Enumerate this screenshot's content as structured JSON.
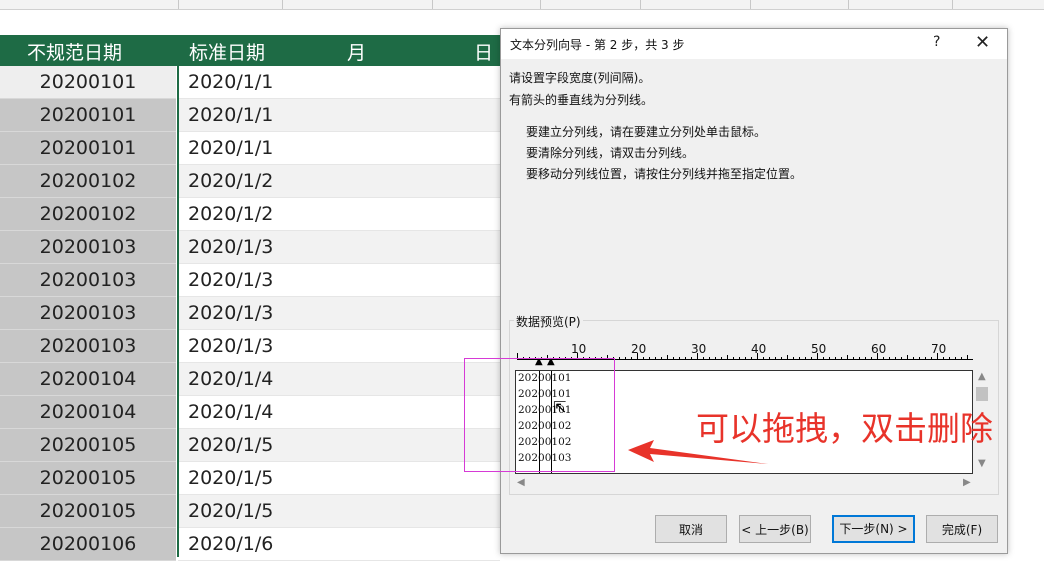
{
  "sheet": {
    "headers": [
      "不规范日期",
      "标准日期",
      "月",
      "日"
    ],
    "rows": [
      [
        "20200101",
        "2020/1/1"
      ],
      [
        "20200101",
        "2020/1/1"
      ],
      [
        "20200101",
        "2020/1/1"
      ],
      [
        "20200102",
        "2020/1/2"
      ],
      [
        "20200102",
        "2020/1/2"
      ],
      [
        "20200103",
        "2020/1/3"
      ],
      [
        "20200103",
        "2020/1/3"
      ],
      [
        "20200103",
        "2020/1/3"
      ],
      [
        "20200103",
        "2020/1/3"
      ],
      [
        "20200104",
        "2020/1/4"
      ],
      [
        "20200104",
        "2020/1/4"
      ],
      [
        "20200105",
        "2020/1/5"
      ],
      [
        "20200105",
        "2020/1/5"
      ],
      [
        "20200105",
        "2020/1/5"
      ],
      [
        "20200106",
        "2020/1/6"
      ]
    ],
    "header_color": "#1e6b45"
  },
  "dialog": {
    "title": "文本分列向导 - 第 2 步，共 3 步",
    "help": "?",
    "close": "✕",
    "line1": "请设置字段宽度(列间隔)。",
    "line2": "有箭头的垂直线为分列线。",
    "tip1": "要建立分列线，请在要建立分列处单击鼠标。",
    "tip2": "要清除分列线，请双击分列线。",
    "tip3": "要移动分列线位置，请按住分列线并拖至指定位置。",
    "preview_label": "数据预览(P)",
    "ruler_numbers": [
      "10",
      "20",
      "30",
      "40",
      "50",
      "60",
      "70"
    ],
    "preview_lines": [
      "20200101",
      "20200101",
      "20200101",
      "20200102",
      "20200102",
      "20200103"
    ],
    "buttons": {
      "cancel": "取消",
      "back": "< 上一步(B)",
      "next": "下一步(N) >",
      "finish": "完成(F)"
    }
  },
  "annotation": {
    "text": "可以拖拽，双击删除",
    "color": "#e8332a"
  }
}
